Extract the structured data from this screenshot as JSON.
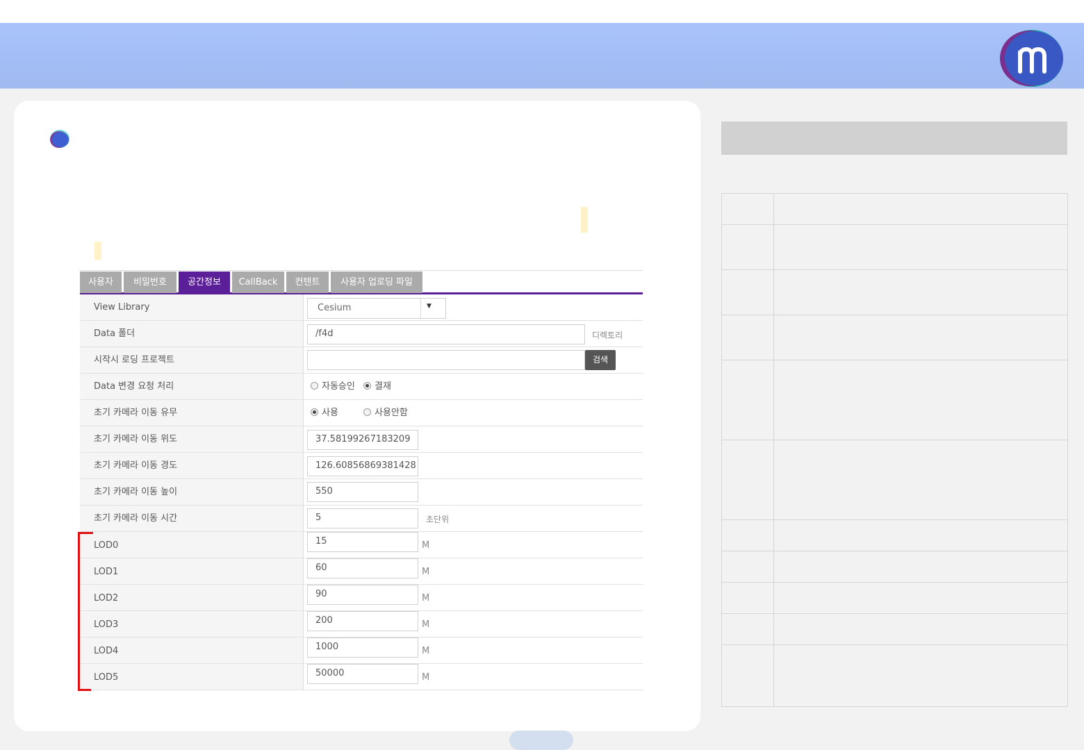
{
  "tabs": [
    "사용자",
    "비밀번호",
    "공간정보",
    "CallBack",
    "컨텐트",
    "사용자 업로딩 파일"
  ],
  "active_tab": "공간정보",
  "form": {
    "view_library": {
      "label": "View Library",
      "value": "Cesium"
    },
    "data_folder": {
      "label": "Data 폴더",
      "value": "/f4d",
      "unit": "디렉토리"
    },
    "start_project": {
      "label": "시작시 로딩 프로젝트",
      "value": "",
      "button": "검색"
    },
    "data_change": {
      "label": "Data 변경 요청 처리",
      "options": [
        "자동승인",
        "결재"
      ],
      "selected": "결재"
    },
    "camera_move": {
      "label": "초기 카메라 이동 유무",
      "options": [
        "사용",
        "사용안함"
      ],
      "selected": "사용"
    },
    "camera_lat": {
      "label": "초기 카메라 이동 위도",
      "value": "37.58199267183209"
    },
    "camera_lon": {
      "label": "초기 카메라 이동 경도",
      "value": "126.60856869381428"
    },
    "camera_height": {
      "label": "초기 카메라 이동 높이",
      "value": "550"
    },
    "camera_time": {
      "label": "초기 카메라 이동 시간",
      "value": "5",
      "unit": "초단위"
    },
    "lod": [
      {
        "label": "LOD0",
        "value": "15",
        "unit": "M"
      },
      {
        "label": "LOD1",
        "value": "60",
        "unit": "M"
      },
      {
        "label": "LOD2",
        "value": "90",
        "unit": "M"
      },
      {
        "label": "LOD3",
        "value": "200",
        "unit": "M"
      },
      {
        "label": "LOD4",
        "value": "1000",
        "unit": "M"
      },
      {
        "label": "LOD5",
        "value": "50000",
        "unit": "M"
      }
    ]
  },
  "colors": {
    "header": "#a3bdf6",
    "active_tab": "#5b1f9a",
    "highlight": "#e01010"
  }
}
